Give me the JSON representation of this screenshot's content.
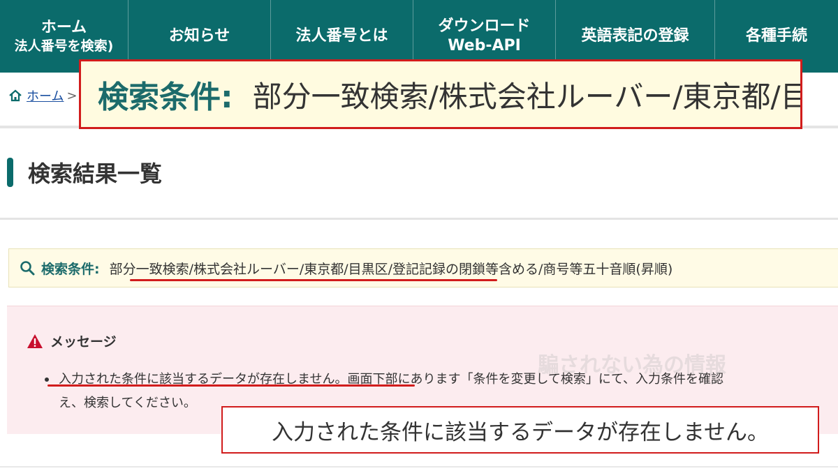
{
  "nav": {
    "items": [
      {
        "line1": "ホーム",
        "line2": "法人番号を検索)"
      },
      {
        "line1": "お知らせ"
      },
      {
        "line1": "法人番号とは"
      },
      {
        "line1": "ダウンロード",
        "line2": "Web-API"
      },
      {
        "line1": "英語表記の登録"
      },
      {
        "line1": "各種手続"
      }
    ]
  },
  "breadcrumb": {
    "home_label": "ホーム",
    "separator": ">"
  },
  "callout_top": {
    "label": "検索条件:",
    "value": "部分一致検索/株式会社ルーバー/東京都/目黒区"
  },
  "page_title": "検索結果一覧",
  "search_condition": {
    "label": "検索条件:",
    "value": "部分一致検索/株式会社ルーバー/東京都/目黒区/登記記録の閉鎖等含める/商号等五十音順(昇順)"
  },
  "message": {
    "heading": "メッセージ",
    "line1": "入力された条件に該当するデータが存在しません。画面下部にあります「条件を変更して検索」にて、入力条件を確認",
    "line2": "え、検索してください。"
  },
  "callout_bottom": {
    "text": "入力された条件に該当するデータが存在しません。"
  },
  "watermark": "騙されない為の情報",
  "colors": {
    "nav_bg": "#0b6b6b",
    "accent_red": "#d11c1c",
    "condition_bg": "#fffbe6",
    "message_bg": "#fcecef"
  }
}
